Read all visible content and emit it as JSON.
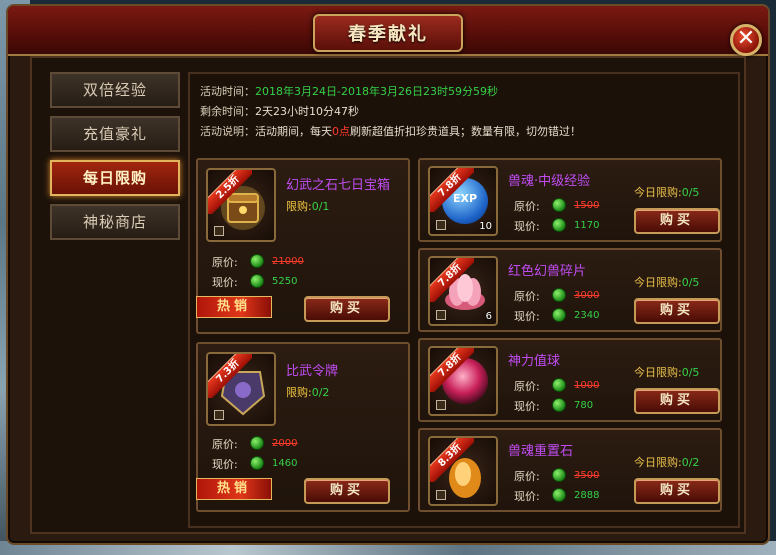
{
  "window": {
    "title": "春季献礼",
    "close_glyph": "✕"
  },
  "tabs": [
    {
      "label": "双倍经验"
    },
    {
      "label": "充值豪礼"
    },
    {
      "label": "每日限购"
    },
    {
      "label": "神秘商店"
    }
  ],
  "info": {
    "time_label": "活动时间：",
    "time_value": "2018年3月24日-2018年3月26日23时59分59秒",
    "remain_label": "剩余时间：",
    "remain_value": "2天23小时10分47秒",
    "desc_label": "活动说明：",
    "desc_part1": "活动期间，每天",
    "desc_highlight": "0点",
    "desc_part2": "刷新超值折扣珍贵道具；数量有限，切勿错过！"
  },
  "labels": {
    "orig_price": "原价:",
    "cur_price": "现价:",
    "buy": "购买",
    "hot": "热销",
    "limit": "限购:",
    "today_limit": "今日限购:"
  },
  "big_items": [
    {
      "name": "幻武之石七日宝箱",
      "discount": "2.5折",
      "limit": "0/1",
      "orig": "21000",
      "cur": "5250"
    },
    {
      "name": "比武令牌",
      "discount": "7.3折",
      "limit": "0/2",
      "orig": "2000",
      "cur": "1460"
    }
  ],
  "small_items": [
    {
      "name": "兽魂·中级经验",
      "discount": "7.8折",
      "today": "0/5",
      "orig": "1500",
      "cur": "1170",
      "count": "10",
      "icon": "exp-orb-icon",
      "icon_text": "EXP"
    },
    {
      "name": "红色幻兽碎片",
      "discount": "7.8折",
      "today": "0/5",
      "orig": "3000",
      "cur": "2340",
      "count": "6",
      "icon": "lotus-icon"
    },
    {
      "name": "神力值球",
      "discount": "7.8折",
      "today": "0/5",
      "orig": "1000",
      "cur": "780",
      "count": "",
      "icon": "power-orb-icon"
    },
    {
      "name": "兽魂重置石",
      "discount": "8.3折",
      "today": "0/2",
      "orig": "3500",
      "cur": "2888",
      "count": "",
      "icon": "reset-stone-icon"
    }
  ],
  "colors": {
    "accent_red": "#a2260e",
    "gold_border": "#c49a56",
    "price_green": "#34d046",
    "strike_red": "#ff3b2b",
    "name_purple": "#c04cf2"
  }
}
